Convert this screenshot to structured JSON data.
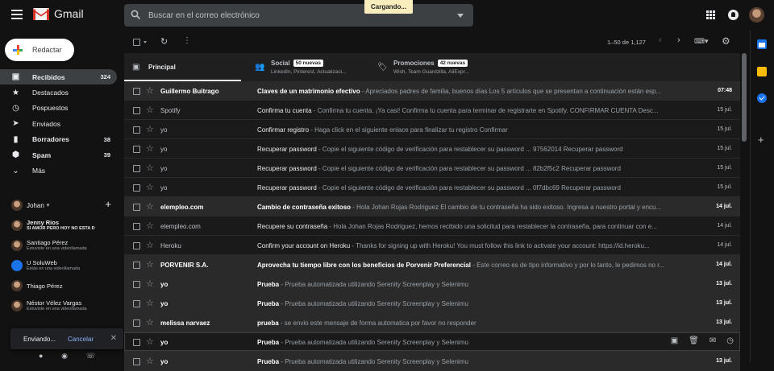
{
  "app": {
    "name": "Gmail",
    "loading": "Cargando..."
  },
  "search": {
    "placeholder": "Buscar en el correo electrónico"
  },
  "compose": {
    "label": "Redactar"
  },
  "nav": [
    {
      "label": "Recibidos",
      "count": "324",
      "icon": "inbox-icon",
      "active": true
    },
    {
      "label": "Destacados",
      "count": "",
      "icon": "star-icon"
    },
    {
      "label": "Pospuestos",
      "count": "",
      "icon": "clock-icon"
    },
    {
      "label": "Enviados",
      "count": "",
      "icon": "send-icon"
    },
    {
      "label": "Borradores",
      "count": "38",
      "icon": "draft-icon",
      "bold": true
    },
    {
      "label": "Spam",
      "count": "39",
      "icon": "spam-icon",
      "bold": true
    },
    {
      "label": "Más",
      "count": "",
      "icon": "chevron-down-icon"
    }
  ],
  "hangouts": {
    "user": "Johan",
    "contacts": [
      {
        "name": "Jenny Rios",
        "status": "SI AMOR PERO HOY NO ESTA D",
        "bold": true
      },
      {
        "name": "Santiago Pérez",
        "status": "Estuviste en una videollamada"
      },
      {
        "name": "U SoluWeb",
        "status": "Estás en una videollamada"
      },
      {
        "name": "Thiago Pérez",
        "status": ""
      },
      {
        "name": "Néstor Vélez Vargas",
        "status": "Estuviste en una videollamada"
      }
    ]
  },
  "sending": {
    "label": "Enviando...",
    "cancel": "Cancelar"
  },
  "toolbar": {
    "range": "1–50 de 1,127"
  },
  "tabs": [
    {
      "label": "Principal",
      "badge": "",
      "sub": ""
    },
    {
      "label": "Social",
      "badge": "50 nuevas",
      "sub": "LinkedIn, Pinterest, Actualizaci..."
    },
    {
      "label": "Promociones",
      "badge": "42 nuevas",
      "sub": "Wish, Team Guardzilla, AliExpr..."
    }
  ],
  "emails": [
    {
      "sender": "Guillermo Buitrago",
      "subject": "Claves de un matrimonio efectivo",
      "snippet": " - Apreciados padres de familia, buenos días Los 5 artículos que se presentan a continuación están esp...",
      "date": "07:48",
      "unread": true
    },
    {
      "sender": "Spotify",
      "subject": "Confirma tu cuenta",
      "snippet": " - Confirma tu cuenta. ¡Ya casi! Confirma tu cuenta para terminar de registrarte en Spotify. CONFIRMAR CUENTA Desc...",
      "date": "15 jul.",
      "unread": false
    },
    {
      "sender": "yo",
      "subject": "Confirmar registro",
      "snippet": " - Haga click en el siguiente enlace para finalizar tu registro Confirmar",
      "date": "15 jul.",
      "unread": false
    },
    {
      "sender": "yo",
      "subject": "Recuperar password",
      "snippet": " - Copie el siguiente código de verificación para restablecer su password ... 97562014 Recuperar password",
      "date": "15 jul.",
      "unread": false
    },
    {
      "sender": "yo",
      "subject": "Recuperar password",
      "snippet": " - Copie el siguiente código de verificación para restablecer su password ... 82b2f5c2 Recuperar password",
      "date": "15 jul.",
      "unread": false
    },
    {
      "sender": "yo",
      "subject": "Recuperar password",
      "snippet": " - Copie el siguiente código de verificación para restablecer su password ... 0f7dbc69 Recuperar password",
      "date": "15 jul.",
      "unread": false
    },
    {
      "sender": "elempleo.com",
      "subject": "Cambio de contraseña exitoso",
      "snippet": " - Hola Johan Rojas Rodriguez El cambio de tu contraseña ha sido exitoso. Ingresa a nuestro portal y encu...",
      "date": "14 jul.",
      "unread": true
    },
    {
      "sender": "elempleo.com",
      "subject": "Recupere su contraseña",
      "snippet": " - Hola Johan Rojas Rodriguez, hemos recibido una solicitud para restablecer la contraseña, para continuar con e...",
      "date": "14 jul.",
      "unread": false
    },
    {
      "sender": "Heroku",
      "subject": "Confirm your account on Heroku",
      "snippet": " - Thanks for signing up with Heroku! You must follow this link to activate your account: https://id.heroku...",
      "date": "14 jul.",
      "unread": false
    },
    {
      "sender": "PORVENIR S.A.",
      "subject": "Aprovecha tu tiempo libre con los beneficios de Porvenir Preferencial",
      "snippet": " - Este correo es de tipo informativo y por lo tanto, le pedimos no r...",
      "date": "14 jul.",
      "unread": true
    },
    {
      "sender": "yo",
      "subject": "Prueba",
      "snippet": " - Prueba automatizada utilizando Serenity Screenplay y Selenimu",
      "date": "13 jul.",
      "unread": true
    },
    {
      "sender": "yo",
      "subject": "Prueba",
      "snippet": " - Prueba automatizada utilizando Serenity Screenplay y Selenimu",
      "date": "13 jul.",
      "unread": true
    },
    {
      "sender": "melissa narvaez",
      "subject": "prueba",
      "snippet": " - se envio este mensaje de forma automatica por favor no responder",
      "date": "13 jul.",
      "unread": true
    },
    {
      "sender": "yo",
      "subject": "Prueba",
      "snippet": " - Prueba automatizada utilizando Serenity Screenplay y Selenimu",
      "date": "",
      "unread": true,
      "hover": true
    },
    {
      "sender": "yo",
      "subject": "Prueba",
      "snippet": " - Prueba automatizada utilizando Serenity Screenplay y Selenimu",
      "date": "13 jul.",
      "unread": true
    }
  ]
}
